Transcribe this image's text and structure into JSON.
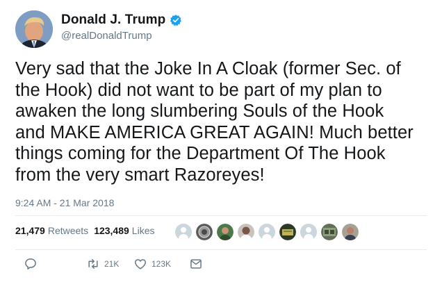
{
  "user": {
    "display_name": "Donald J. Trump",
    "handle": "@realDonaldTrump",
    "verified": true,
    "verified_color": "#1da1f2"
  },
  "tweet": {
    "text_lines": [
      "Very sad that the Joke In A Cloak (former Sec. of",
      "the Hook) did not want to be part of my plan to",
      "awaken the long slumbering Souls of the Hook",
      "and MAKE AMERICA GREAT AGAIN! Much better",
      "things coming for the Department Of The Hook",
      "from the very smart Razoreyes!"
    ],
    "timestamp": "9:24 AM - 21 Mar 2018"
  },
  "stats": {
    "retweets_count": "21,479",
    "retweets_label": "Retweets",
    "likes_count": "123,489",
    "likes_label": "Likes"
  },
  "actions": {
    "reply_icon": "reply-icon",
    "retweet_icon": "retweet-icon",
    "retweet_count": "21K",
    "like_icon": "heart-icon",
    "like_count": "123K",
    "message_icon": "envelope-icon"
  },
  "colors": {
    "text": "#14171a",
    "secondary": "#657786",
    "divider": "#e6ecf0"
  }
}
